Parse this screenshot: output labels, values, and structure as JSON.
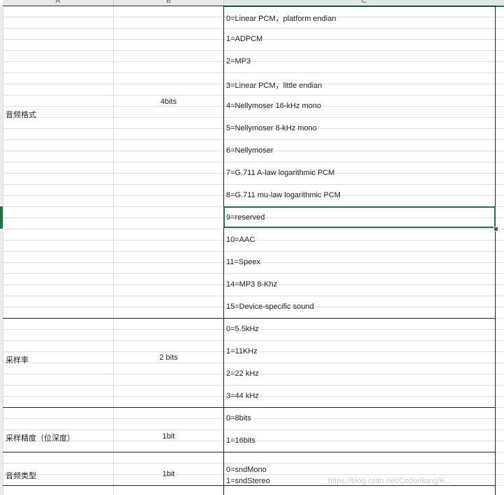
{
  "columns": [
    "A",
    "B",
    "C"
  ],
  "groups": [
    {
      "name": "音频格式",
      "bits": "4bits",
      "values": [
        "0=Linear PCM，platform endian",
        "1=ADPCM",
        "2=MP3",
        "3=Linear PCM，little endian",
        "4=Nellymoser 16-kHz mono",
        "5=Nellymoser 8-kHz mono",
        "6=Nellymoser",
        "7=G.711 A-law logarithmic PCM",
        "8=G.711 mu-law logarithmic PCM",
        "9=reserved",
        "10=AAC",
        "11=Speex",
        "14=MP3 8-Khz",
        "15=Device-specific sound"
      ]
    },
    {
      "name": "采样率",
      "bits": "2 bits",
      "values": [
        "0=5.5kHz",
        "1=11KHz",
        "2=22 kHz",
        "3=44 kHz"
      ]
    },
    {
      "name": "采样精度（位深度）",
      "bits": "1bit",
      "values": [
        "0=8bits",
        "1=16bits"
      ]
    },
    {
      "name": "音频类型",
      "bits": "1bit",
      "values": [
        "0=sndMono",
        "1=sndStereo"
      ]
    }
  ],
  "selected_cell_value": "9=reserved",
  "watermark": "https://blog.csdn.net/Coderlliang/6..."
}
